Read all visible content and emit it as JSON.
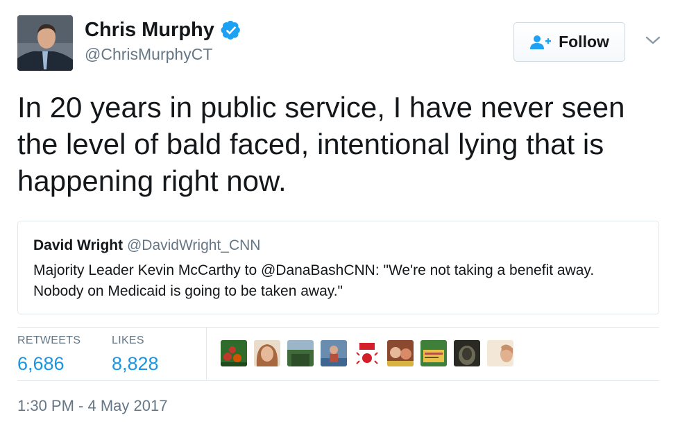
{
  "author": {
    "name": "Chris Murphy",
    "handle": "@ChrisMurphyCT",
    "verified": true,
    "avatar_icon": "profile-photo"
  },
  "follow_button": {
    "label": "Follow",
    "icon": "add-user-icon"
  },
  "tweet": {
    "text": "In 20 years in public service, I have never seen the level of bald faced, intentional lying that is happening right now."
  },
  "quoted_tweet": {
    "name": "David Wright",
    "handle": "@DavidWright_CNN",
    "text": "Majority Leader Kevin McCarthy to @DanaBashCNN: \"We're not taking a benefit away. Nobody on Medicaid is going to be taken away.\""
  },
  "stats": {
    "retweets_label": "RETWEETS",
    "retweets_value": "6,686",
    "likes_label": "LIKES",
    "likes_value": "8,828"
  },
  "likers": [
    {
      "name": "liker-avatar-1",
      "colors": [
        "#2f6b2a",
        "#c0392b"
      ]
    },
    {
      "name": "liker-avatar-2",
      "colors": [
        "#caa07a",
        "#8a5a3c"
      ]
    },
    {
      "name": "liker-avatar-3",
      "colors": [
        "#3f6a3a",
        "#9bb6c9"
      ]
    },
    {
      "name": "liker-avatar-4",
      "colors": [
        "#6a8caf",
        "#b5503f"
      ]
    },
    {
      "name": "liker-avatar-5",
      "colors": [
        "#ffffff",
        "#d21f2a"
      ]
    },
    {
      "name": "liker-avatar-6",
      "colors": [
        "#d98a68",
        "#8b4a2f"
      ]
    },
    {
      "name": "liker-avatar-7",
      "colors": [
        "#3e7f3a",
        "#e8c14a"
      ]
    },
    {
      "name": "liker-avatar-8",
      "colors": [
        "#3a3a30",
        "#6d6a55"
      ]
    },
    {
      "name": "liker-avatar-9",
      "colors": [
        "#efe1cf",
        "#d4a07d"
      ]
    }
  ],
  "timestamp": "1:30 PM - 4 May 2017",
  "colors": {
    "link_blue": "#1b95e0",
    "verified_blue": "#1da1f2",
    "muted_gray": "#657786",
    "border": "#e1e8ed"
  }
}
